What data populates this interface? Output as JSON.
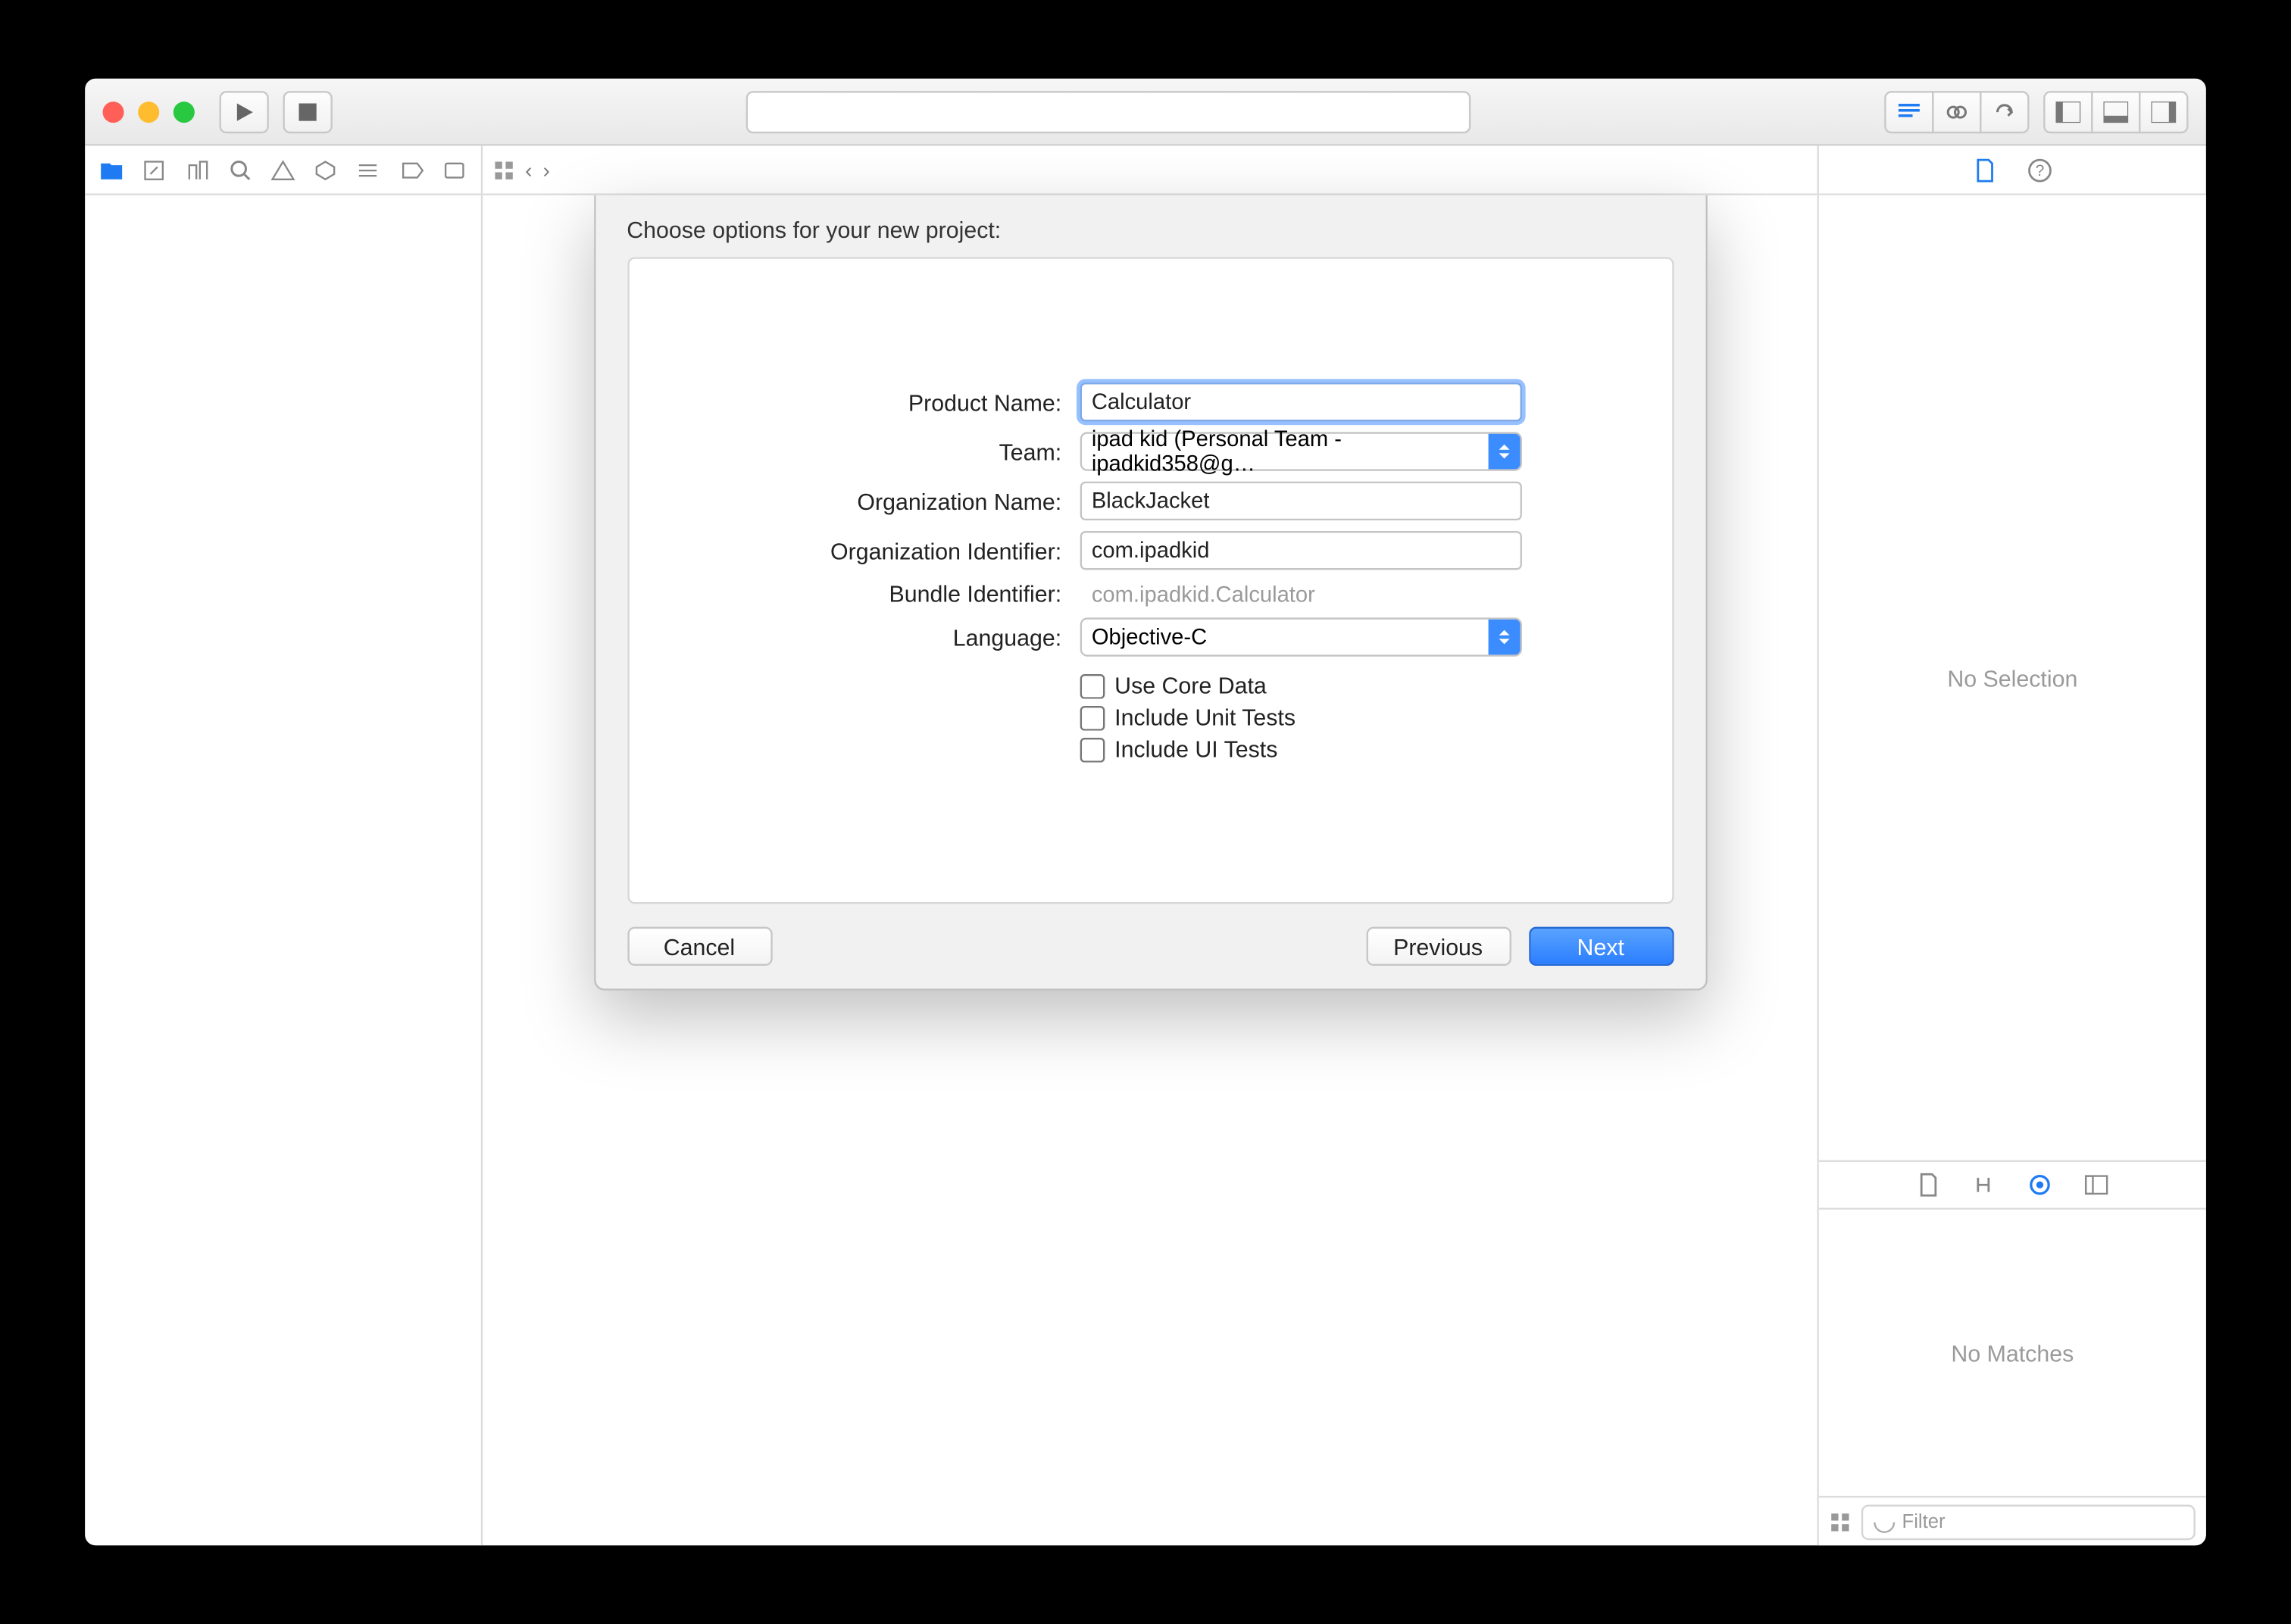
{
  "sheet": {
    "title": "Choose options for your new project:",
    "labels": {
      "productName": "Product Name:",
      "team": "Team:",
      "orgName": "Organization Name:",
      "orgId": "Organization Identifier:",
      "bundleId": "Bundle Identifier:",
      "language": "Language:"
    },
    "values": {
      "productName": "Calculator",
      "team": "ipad kid (Personal Team - ipadkid358@g…",
      "orgName": "BlackJacket",
      "orgId": "com.ipadkid",
      "bundleId": "com.ipadkid.Calculator",
      "language": "Objective-C"
    },
    "checks": {
      "coreData": "Use Core Data",
      "unitTests": "Include Unit Tests",
      "uiTests": "Include UI Tests"
    },
    "buttons": {
      "cancel": "Cancel",
      "previous": "Previous",
      "next": "Next"
    }
  },
  "right": {
    "noSelection": "No Selection",
    "noMatches": "No Matches",
    "filterPlaceholder": "Filter"
  }
}
